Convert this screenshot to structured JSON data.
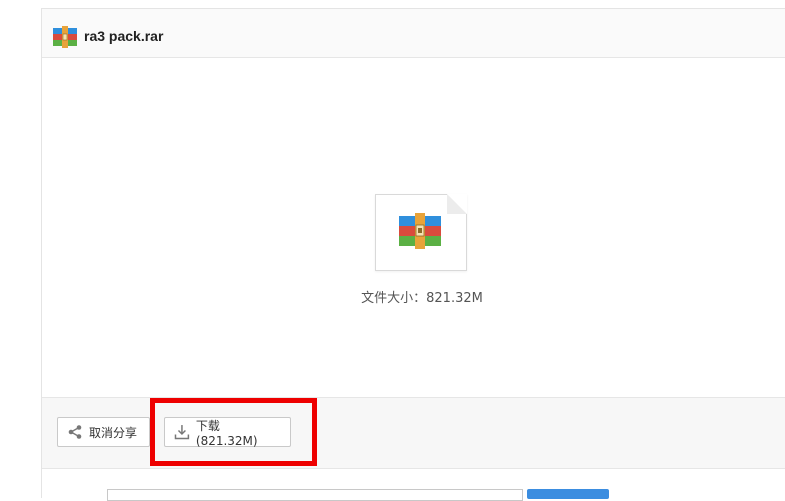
{
  "header": {
    "file_name": "ra3 pack.rar",
    "icon": "winrar-archive-icon"
  },
  "preview": {
    "icon": "winrar-archive-icon",
    "file_size_text": "文件大小：821.32M"
  },
  "toolbar": {
    "cancel_share_label": "取消分享",
    "cancel_share_icon": "share-icon",
    "download_label": "下载(821.32M)",
    "download_icon": "download-icon"
  },
  "colors": {
    "highlight": "#ee0000",
    "primary_button": "#3b8de0"
  }
}
